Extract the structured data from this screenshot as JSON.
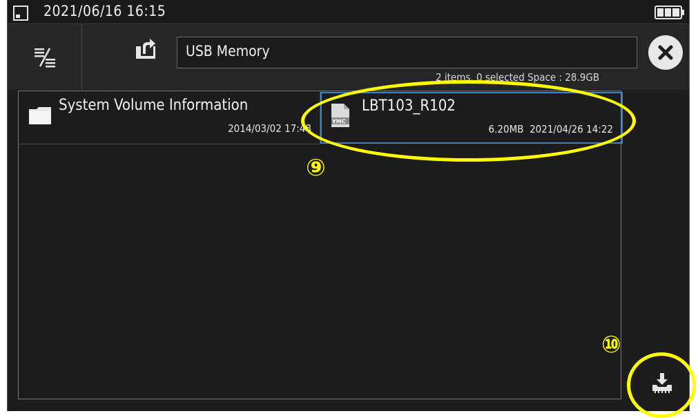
{
  "status_bar": {
    "datetime": "2021/06/16 16:15",
    "storage_icon": "sd-card-icon",
    "battery_icon": "battery-full-icon"
  },
  "toolbar": {
    "view_toggle_icon": "list-view-icon",
    "up_folder_icon": "folder-up-icon",
    "path": "USB Memory",
    "close_icon": "close-icon"
  },
  "info": {
    "line": "2 items, 0 selected  Space : 28.9GB"
  },
  "files": [
    {
      "name": "System Volume Information",
      "type": "folder",
      "icon": "folder-icon",
      "size": "",
      "date": "2014/03/02 17:48"
    },
    {
      "name": "LBT103_R102",
      "type": "file",
      "icon": "ymc-file-icon",
      "size": "6.20MB",
      "date": "2021/04/26 14:22"
    }
  ],
  "actions": {
    "save_icon": "download-to-device-icon"
  },
  "annotations": {
    "file_marker": "⑨",
    "save_marker": "⑩",
    "highlight_color": "#ffff00"
  },
  "colors": {
    "background": "#1d1d1d",
    "selection_border": "#3d86c6",
    "text": "#f2f2f2"
  }
}
